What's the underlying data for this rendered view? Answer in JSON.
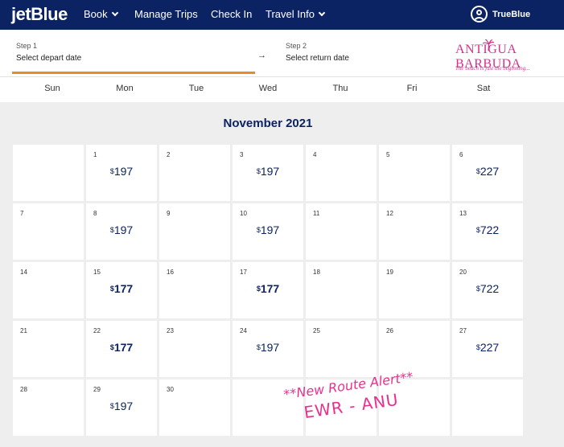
{
  "nav": {
    "logo": "jetBlue",
    "items": [
      "Book",
      "Manage Trips",
      "Check In",
      "Travel Info"
    ],
    "trueblue": "TrueBlue"
  },
  "steps": {
    "step1_label": "Step 1",
    "step1_value": "Select depart date",
    "arrow": "→",
    "step2_label": "Step 2",
    "step2_value": "Select return date"
  },
  "ad": {
    "title": "ANTIGUA BARBUDA",
    "and": "AND",
    "tagline": "The beach is just the beginning..."
  },
  "weekdays": [
    "Sun",
    "Mon",
    "Tue",
    "Wed",
    "Thu",
    "Fri",
    "Sat"
  ],
  "calendar": {
    "month": "November 2021",
    "currency": "$",
    "weeks": [
      [
        {
          "day": "",
          "price": ""
        },
        {
          "day": "1",
          "price": "197"
        },
        {
          "day": "2",
          "price": ""
        },
        {
          "day": "3",
          "price": "197"
        },
        {
          "day": "4",
          "price": ""
        },
        {
          "day": "5",
          "price": ""
        },
        {
          "day": "6",
          "price": "227"
        }
      ],
      [
        {
          "day": "7",
          "price": ""
        },
        {
          "day": "8",
          "price": "197"
        },
        {
          "day": "9",
          "price": ""
        },
        {
          "day": "10",
          "price": "197"
        },
        {
          "day": "11",
          "price": ""
        },
        {
          "day": "12",
          "price": ""
        },
        {
          "day": "13",
          "price": "722"
        }
      ],
      [
        {
          "day": "14",
          "price": ""
        },
        {
          "day": "15",
          "price": "177",
          "low": true
        },
        {
          "day": "16",
          "price": ""
        },
        {
          "day": "17",
          "price": "177",
          "low": true
        },
        {
          "day": "18",
          "price": ""
        },
        {
          "day": "19",
          "price": ""
        },
        {
          "day": "20",
          "price": "722"
        }
      ],
      [
        {
          "day": "21",
          "price": ""
        },
        {
          "day": "22",
          "price": "177",
          "low": true
        },
        {
          "day": "23",
          "price": ""
        },
        {
          "day": "24",
          "price": "197"
        },
        {
          "day": "25",
          "price": ""
        },
        {
          "day": "26",
          "price": ""
        },
        {
          "day": "27",
          "price": "227"
        }
      ],
      [
        {
          "day": "28",
          "price": ""
        },
        {
          "day": "29",
          "price": "197"
        },
        {
          "day": "30",
          "price": ""
        },
        {
          "day": "",
          "price": ""
        },
        {
          "day": "",
          "price": ""
        },
        {
          "day": "",
          "price": ""
        },
        {
          "day": "",
          "price": ""
        }
      ]
    ]
  },
  "promo": {
    "line1": "**New Route Alert**",
    "line2": "EWR - ANU"
  },
  "colors": {
    "nav_bg": "#0b2362",
    "accent_orange": "#e88a2b",
    "promo_pink": "#e7318c",
    "price_navy": "#0b2362"
  }
}
